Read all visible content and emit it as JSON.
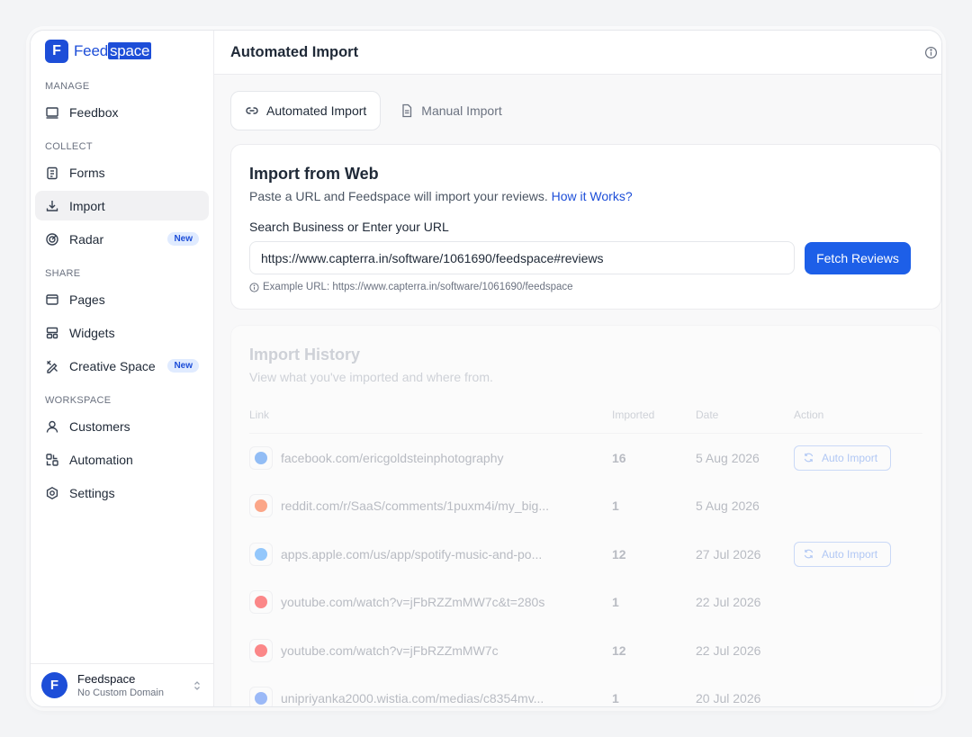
{
  "brand": {
    "mark": "F",
    "name_a": "Feed",
    "name_b": "space"
  },
  "sidebar": {
    "sections": [
      {
        "label": "MANAGE",
        "items": [
          {
            "label": "Feedbox",
            "icon": "inbox-icon"
          }
        ]
      },
      {
        "label": "COLLECT",
        "items": [
          {
            "label": "Forms",
            "icon": "clipboard-icon"
          },
          {
            "label": "Import",
            "icon": "download-icon",
            "active": true
          },
          {
            "label": "Radar",
            "icon": "radar-icon",
            "badge": "New"
          }
        ]
      },
      {
        "label": "SHARE",
        "items": [
          {
            "label": "Pages",
            "icon": "browser-icon"
          },
          {
            "label": "Widgets",
            "icon": "widget-icon"
          },
          {
            "label": "Creative Space",
            "icon": "pencil-ruler-icon",
            "badge": "New"
          }
        ]
      },
      {
        "label": "WORKSPACE",
        "items": [
          {
            "label": "Customers",
            "icon": "user-icon"
          },
          {
            "label": "Automation",
            "icon": "automation-icon"
          },
          {
            "label": "Settings",
            "icon": "gear-icon"
          }
        ]
      }
    ],
    "workspace": {
      "avatar": "F",
      "name": "Feedspace",
      "sub": "No Custom Domain"
    }
  },
  "header": {
    "title": "Automated Import"
  },
  "tabs": [
    {
      "label": "Automated Import",
      "active": true
    },
    {
      "label": "Manual Import",
      "active": false
    }
  ],
  "import_card": {
    "title": "Import from Web",
    "desc": "Paste a URL and Feedspace will import your reviews.",
    "link": "How it Works?",
    "field_label": "Search Business or Enter your URL",
    "url_value": "https://www.capterra.in/software/1061690/feedspace#reviews",
    "button": "Fetch Reviews",
    "example": "Example URL: https://www.capterra.in/software/1061690/feedspace"
  },
  "history": {
    "title": "Import History",
    "desc": "View what you've imported and where from.",
    "columns": [
      "Link",
      "Imported",
      "Date",
      "Action"
    ],
    "rows": [
      {
        "source": "facebook",
        "color": "#1877f2",
        "link": "facebook.com/ericgoldsteinphotography",
        "imported": "16",
        "date": "5 Aug 2026",
        "action": "Auto Import"
      },
      {
        "source": "reddit",
        "color": "#ff4500",
        "link": "reddit.com/r/SaaS/comments/1puxm4i/my_big...",
        "imported": "1",
        "date": "5 Aug 2026",
        "action": ""
      },
      {
        "source": "app-store",
        "color": "#1a8cff",
        "link": "apps.apple.com/us/app/spotify-music-and-po...",
        "imported": "12",
        "date": "27 Jul 2026",
        "action": "Auto Import"
      },
      {
        "source": "youtube",
        "color": "#ff0000",
        "link": "youtube.com/watch?v=jFbRZZmMW7c&t=280s",
        "imported": "1",
        "date": "22 Jul 2026",
        "action": ""
      },
      {
        "source": "youtube",
        "color": "#ff0000",
        "link": "youtube.com/watch?v=jFbRZZmMW7c",
        "imported": "12",
        "date": "22 Jul 2026",
        "action": ""
      },
      {
        "source": "wistia",
        "color": "#2c6ff5",
        "link": "unipriyanka2000.wistia.com/medias/c8354mv...",
        "imported": "1",
        "date": "20 Jul 2026",
        "action": ""
      }
    ]
  }
}
